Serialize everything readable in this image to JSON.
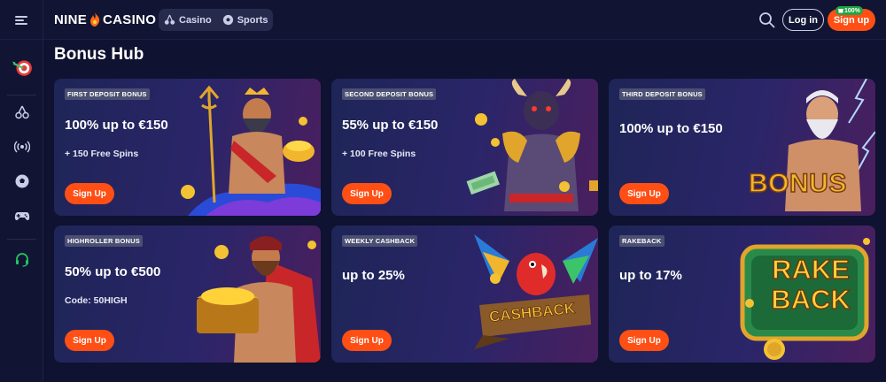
{
  "header": {
    "logo_left": "NINE",
    "logo_right": "CASINO",
    "nav": [
      {
        "label": "Casino",
        "icon": "cherries-icon"
      },
      {
        "label": "Sports",
        "icon": "soccer-ball-icon"
      }
    ],
    "login_label": "Log in",
    "signup_label": "Sign up",
    "signup_badge": "100%"
  },
  "sidebar": {
    "items": [
      {
        "icon": "target-dart-icon",
        "active": true
      },
      {
        "icon": "cherries-icon"
      },
      {
        "icon": "live-broadcast-icon"
      },
      {
        "icon": "soccer-ball-icon"
      },
      {
        "icon": "gamepad-icon"
      },
      {
        "icon": "headset-support-icon",
        "color": "#22c55e"
      }
    ]
  },
  "page": {
    "title": "Bonus Hub"
  },
  "cards": [
    {
      "tag": "FIRST DEPOSIT BONUS",
      "headline": "100% up to €150",
      "sub": "+ 150 Free Spins",
      "cta": "Sign Up",
      "art": "sea-god-trident"
    },
    {
      "tag": "SECOND DEPOSIT BONUS",
      "headline": "55% up to €150",
      "sub": "+ 100 Free Spins",
      "cta": "Sign Up",
      "art": "minotaur-warrior"
    },
    {
      "tag": "THIRD DEPOSIT BONUS",
      "headline": "100% up to €150",
      "sub": "",
      "cta": "Sign Up",
      "art": "zeus-bonus",
      "art_text": "BONUS"
    },
    {
      "tag": "HIGHROLLER BONUS",
      "headline": "50% up to €500",
      "sub": "Code: 50HIGH",
      "cta": "Sign Up",
      "art": "treasure-chest-hero"
    },
    {
      "tag": "WEEKLY CASHBACK",
      "headline": "up to 25%",
      "sub": "",
      "cta": "Sign Up",
      "art": "parrot-cashback",
      "art_text": "CASHBACK"
    },
    {
      "tag": "RAKEBACK",
      "headline": "up to 17%",
      "sub": "",
      "cta": "Sign Up",
      "art": "rakeback-sign",
      "art_text": "RAKE BACK"
    }
  ],
  "colors": {
    "background": "#0f1230",
    "accent": "#ff4f14",
    "badge": "#1ea543",
    "tag": "#4b5073"
  }
}
